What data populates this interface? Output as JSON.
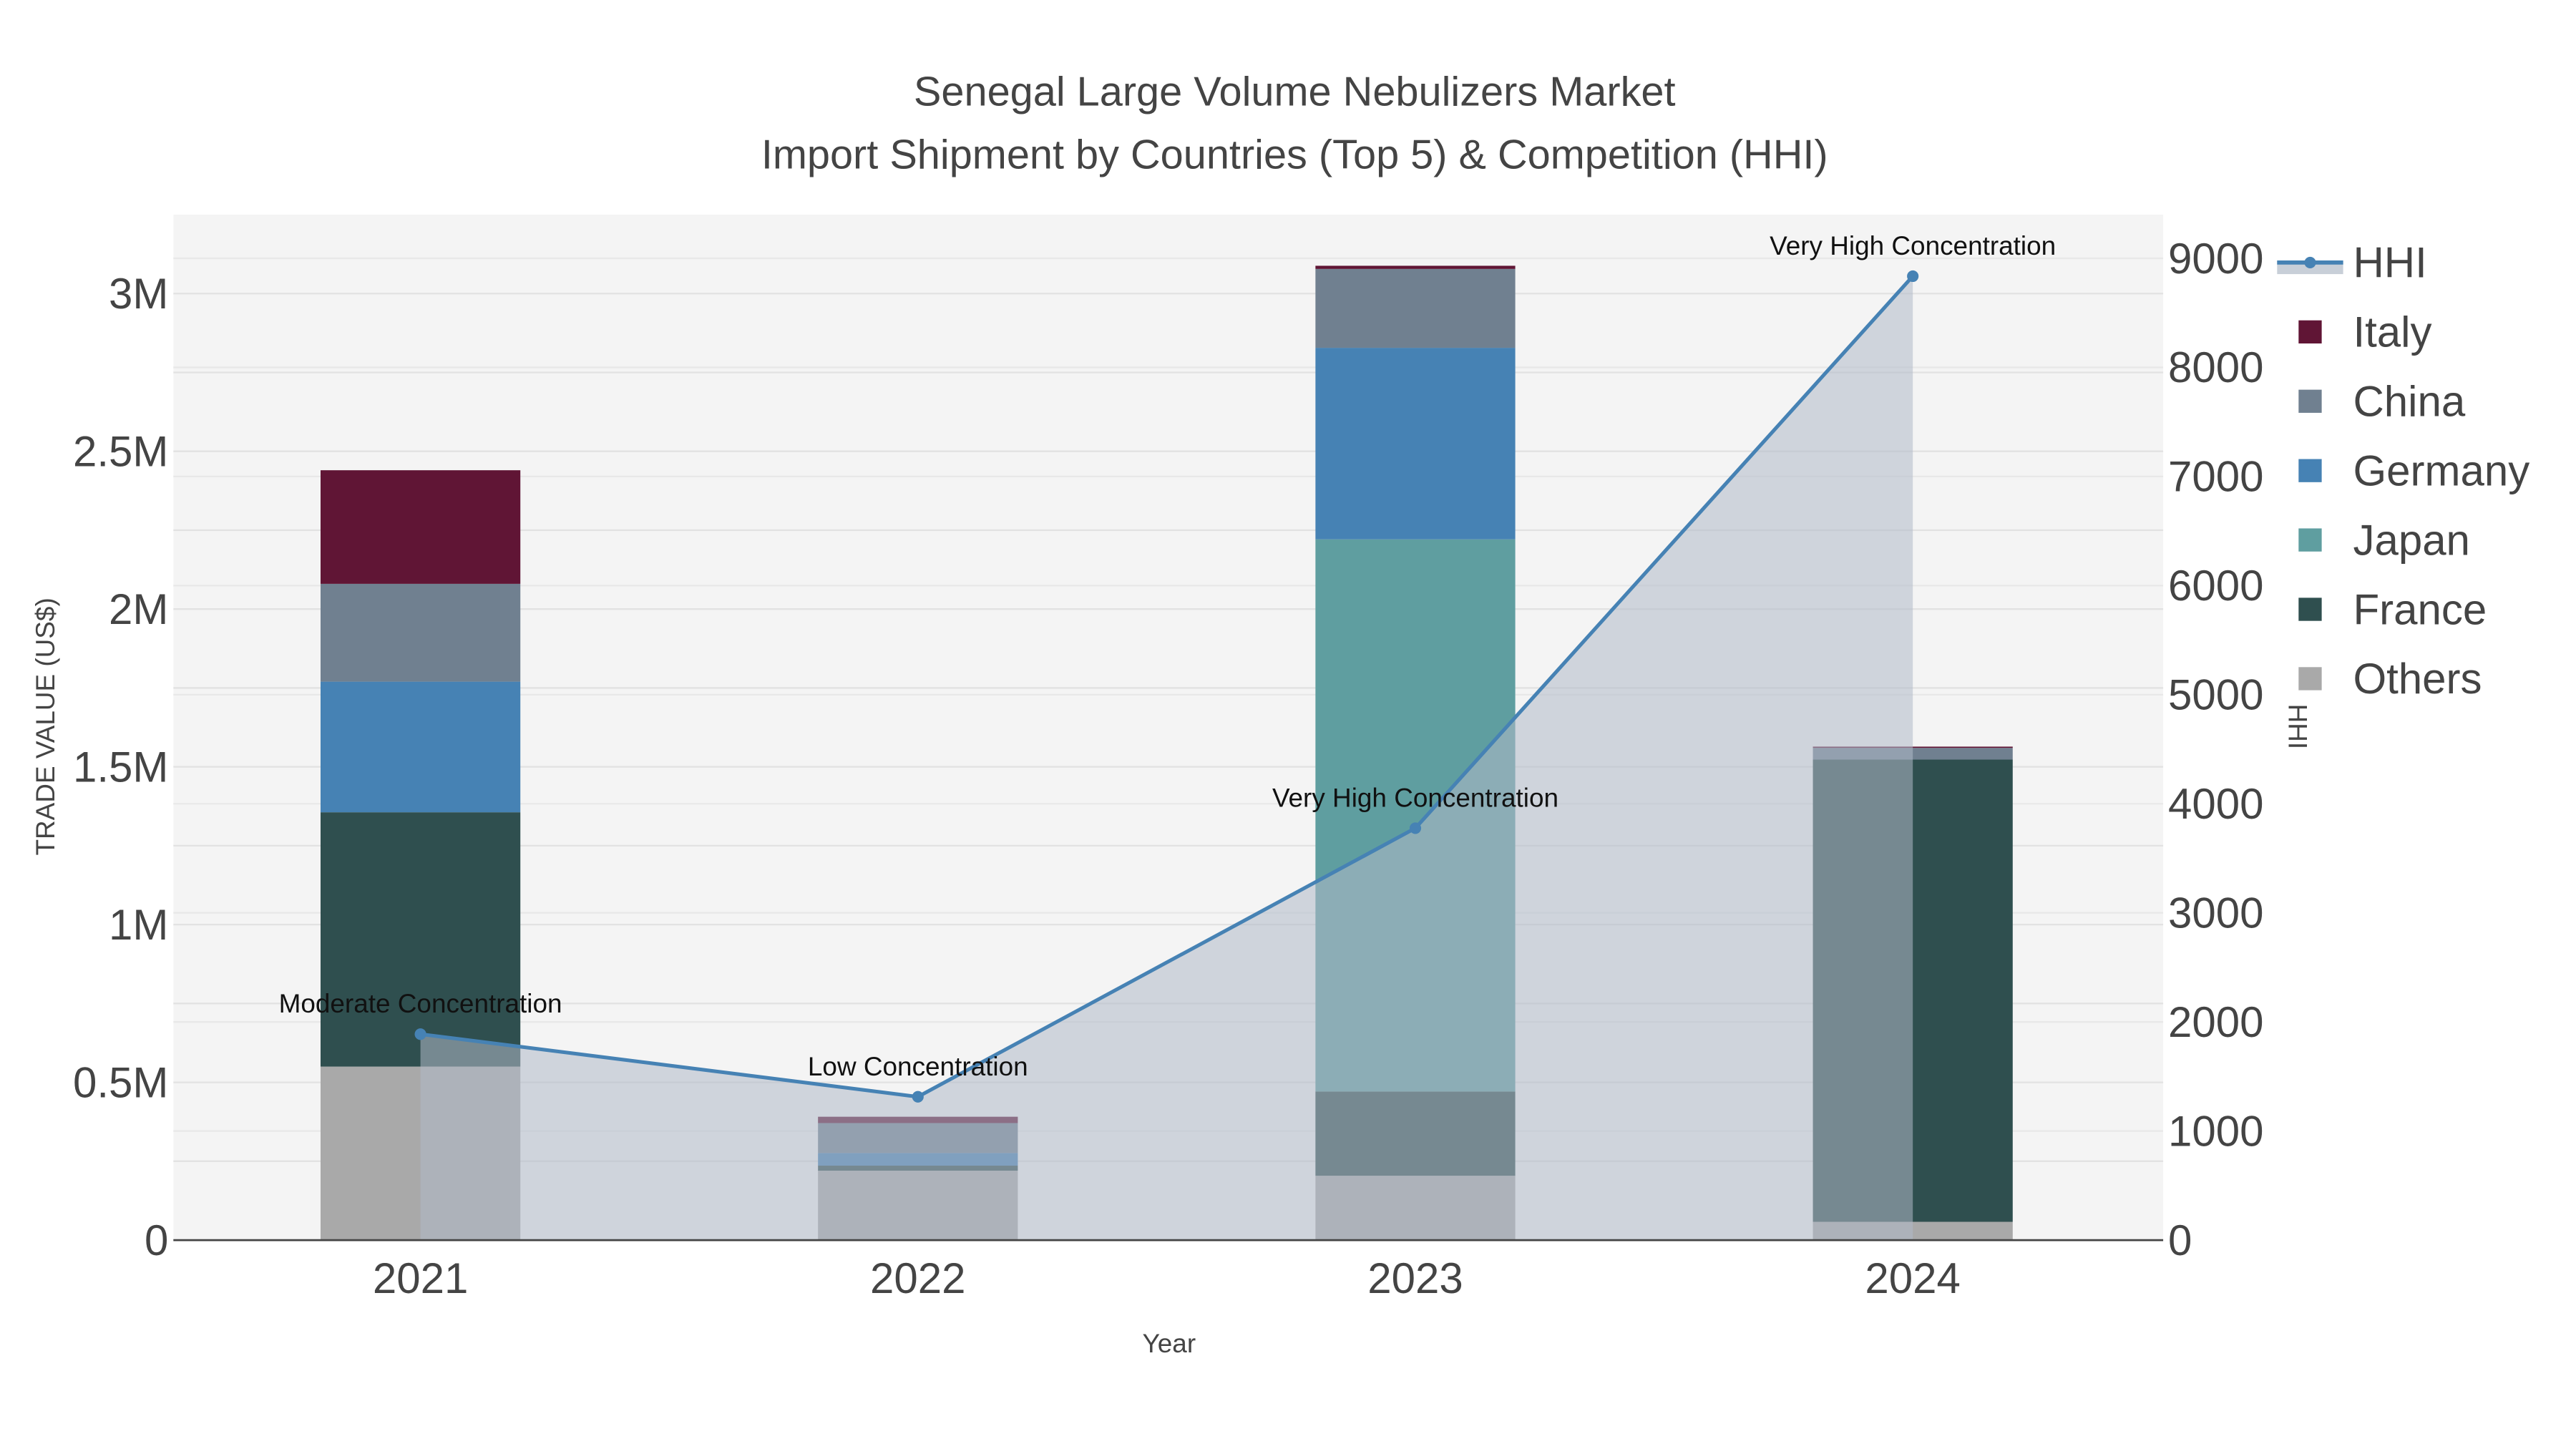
{
  "chart_data": {
    "type": "bar",
    "title": "Senegal Large Volume Nebulizers Market",
    "subtitle": "Import Shipment by Countries (Top 5) & Competition (HHI)",
    "xlabel": "Year",
    "ylabel": "TRADE VALUE (US$)",
    "y2label": "HHI",
    "categories": [
      "2021",
      "2022",
      "2023",
      "2024"
    ],
    "ylim": [
      0,
      3250000
    ],
    "y2lim": [
      0,
      9400
    ],
    "yticks": [
      {
        "v": 0,
        "label": "0"
      },
      {
        "v": 500000,
        "label": "0.5M"
      },
      {
        "v": 1000000,
        "label": "1M"
      },
      {
        "v": 1500000,
        "label": "1.5M"
      },
      {
        "v": 2000000,
        "label": "2M"
      },
      {
        "v": 2500000,
        "label": "2.5M"
      },
      {
        "v": 3000000,
        "label": "3M"
      }
    ],
    "y2ticks": [
      0,
      1000,
      2000,
      3000,
      4000,
      5000,
      6000,
      7000,
      8000,
      9000
    ],
    "series": [
      {
        "name": "Others",
        "color": "#a9a9a9",
        "values": [
          550000,
          220000,
          204000,
          58000
        ]
      },
      {
        "name": "France",
        "color": "#2f4f4f",
        "values": [
          806000,
          16000,
          267000,
          1465000
        ]
      },
      {
        "name": "Japan",
        "color": "#5f9ea0",
        "values": [
          0,
          0,
          1750000,
          0
        ]
      },
      {
        "name": "Germany",
        "color": "#4682b4",
        "values": [
          414000,
          40000,
          607000,
          0
        ]
      },
      {
        "name": "China",
        "color": "#708090",
        "values": [
          310000,
          95000,
          250000,
          37000
        ]
      },
      {
        "name": "Italy",
        "color": "#601535",
        "values": [
          360000,
          20000,
          10000,
          4000
        ]
      }
    ],
    "hhi": {
      "name": "HHI",
      "color": "#4682b4",
      "values": [
        1888,
        1314,
        3776,
        8836
      ],
      "annotations": [
        "Moderate Concentration",
        "Low Concentration",
        "Very High Concentration",
        "Very High Concentration"
      ]
    },
    "legend_order": [
      "HHI",
      "Italy",
      "China",
      "Germany",
      "Japan",
      "France",
      "Others"
    ],
    "legend_position": "right",
    "grid": true
  }
}
